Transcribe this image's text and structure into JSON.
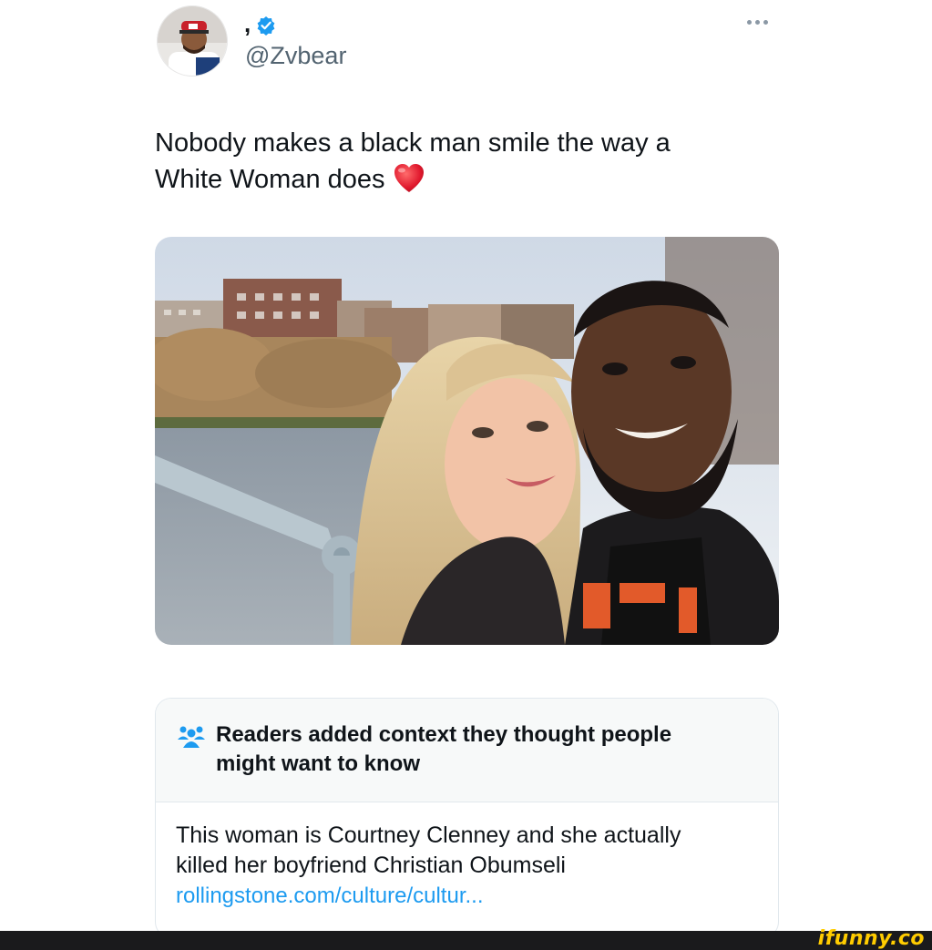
{
  "tweet": {
    "display_name": ",",
    "handle": "@Zvbear",
    "text_line1": "Nobody makes a black man smile the way a",
    "text_line2": "White Woman does",
    "heart_emoji": "red-heart",
    "verified_color": "#1d9bf0"
  },
  "community_note": {
    "title_line1": "Readers added context they thought people",
    "title_line2": "might want to know",
    "body_line1": "This woman is Courtney Clenney and she actually",
    "body_line2": "killed her boyfriend Christian Obumseli",
    "link": "rollingstone.com/culture/cultur..."
  },
  "watermark": {
    "text": "ifunny.co",
    "color": "#ffcc00"
  }
}
